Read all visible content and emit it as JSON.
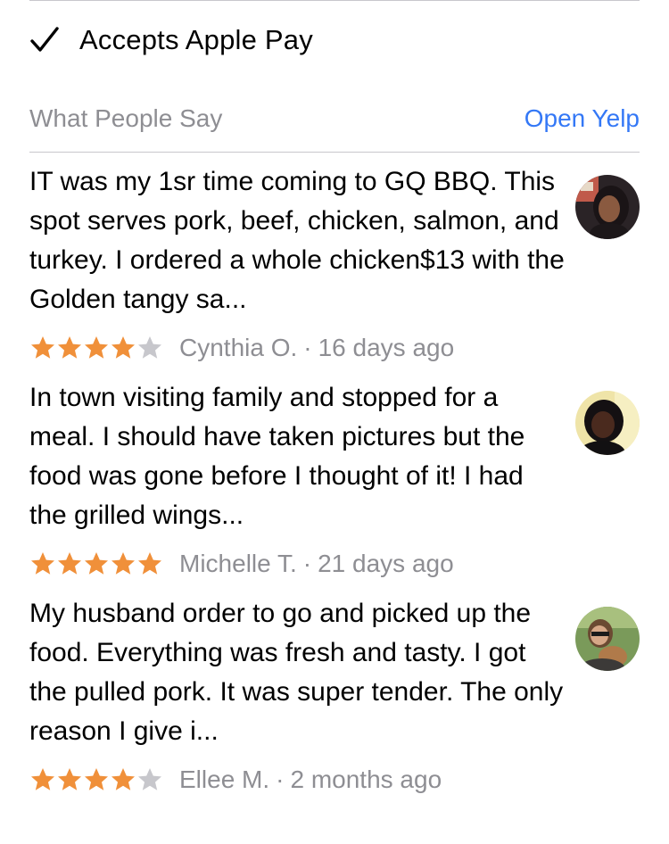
{
  "amenity": {
    "icon": "checkmark-icon",
    "label": "Accepts Apple Pay"
  },
  "section": {
    "title": "What People Say",
    "link_label": "Open Yelp",
    "link_color": "#3478f6"
  },
  "reviews": [
    {
      "text": "IT was my 1sr time coming to GQ BBQ. This spot serves pork, beef, chicken, salmon, and turkey. I ordered a whole chicken$13 with the Golden tangy sa...",
      "rating": 4,
      "author": "Cynthia O.",
      "separator": "·",
      "age": "16 days ago",
      "avatar_icon": "avatar-photo"
    },
    {
      "text": "In town visiting family and stopped for a meal. I should have taken pictures but the food was gone before I thought of it! I had the grilled wings...",
      "rating": 5,
      "author": "Michelle T.",
      "separator": "·",
      "age": "21 days ago",
      "avatar_icon": "avatar-photo"
    },
    {
      "text": "My husband order to go and picked up the food. Everything was fresh and tasty. I got the pulled pork. It was super tender. The only reason I give i...",
      "rating": 4,
      "author": "Ellee M.",
      "separator": "·",
      "age": "2 months ago",
      "avatar_icon": "avatar-photo"
    }
  ],
  "colors": {
    "star_filled": "#f0903a",
    "star_empty": "#c7c7cc",
    "secondary_text": "#8e8e93",
    "divider": "#c8c7cc"
  }
}
